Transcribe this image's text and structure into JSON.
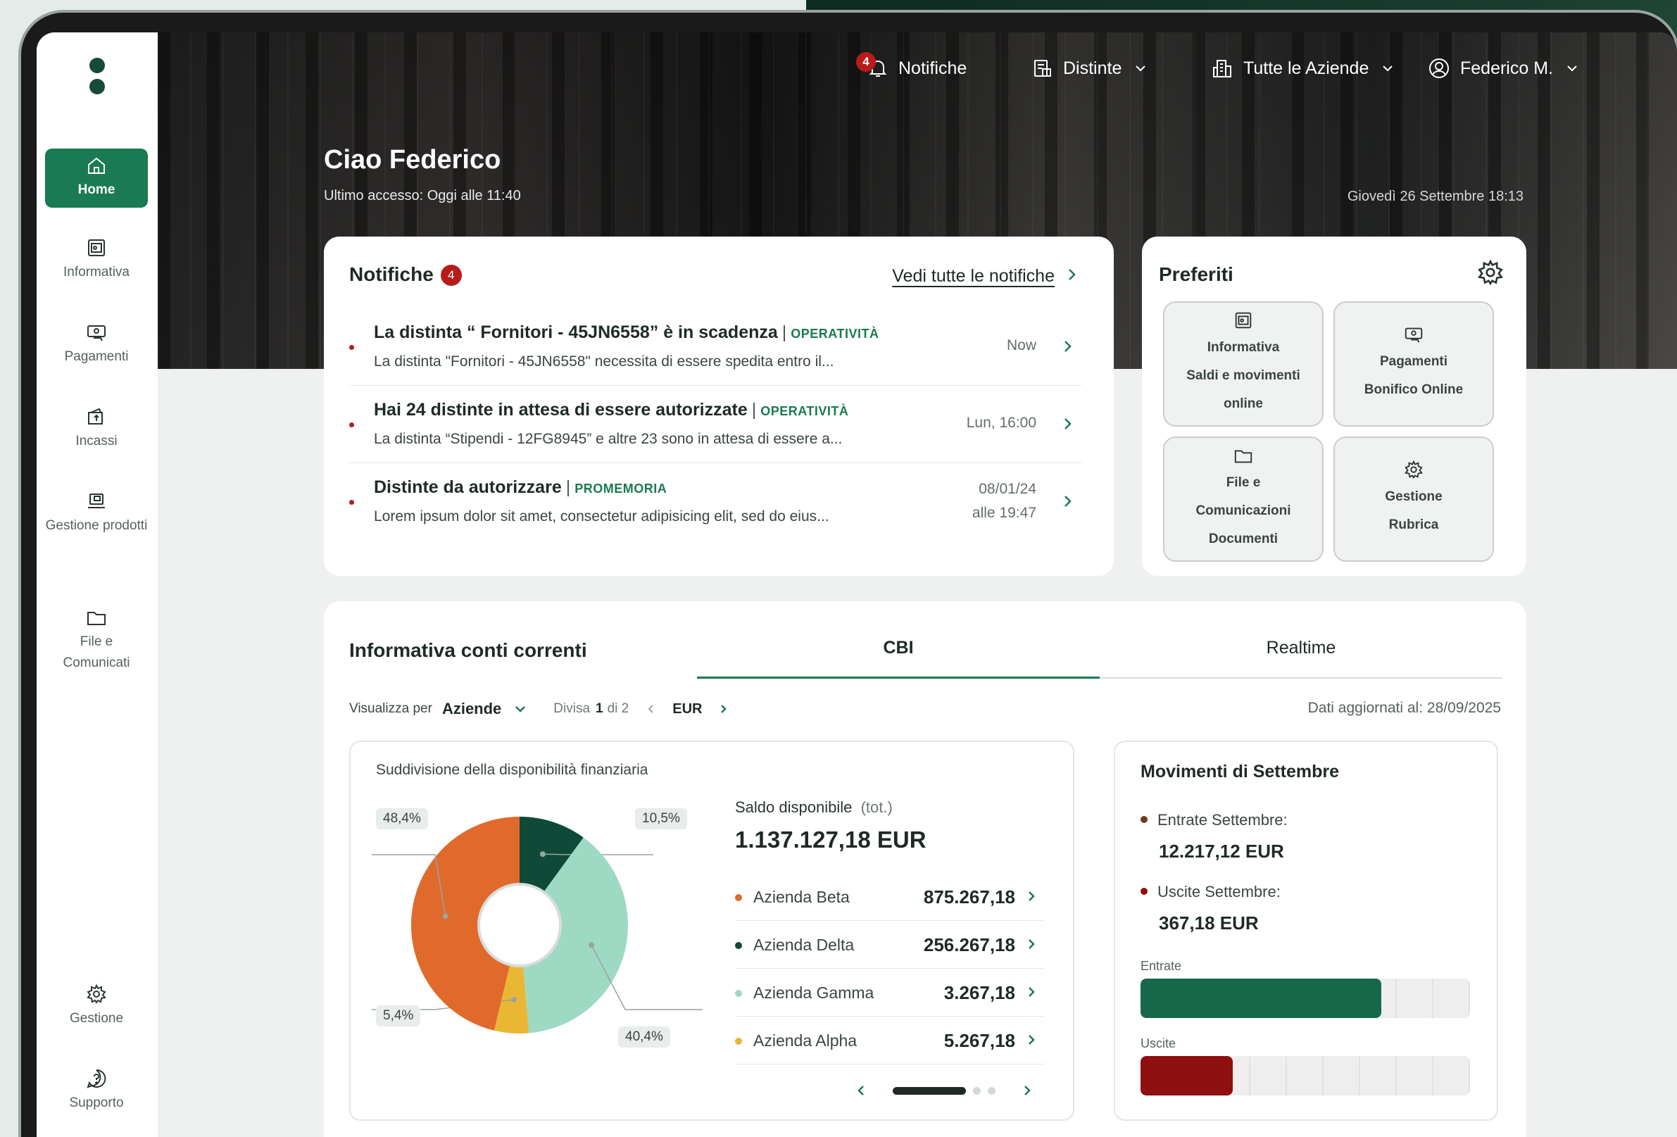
{
  "header": {
    "notifications_label": "Notifiche",
    "notifications_count": "4",
    "distinte_label": "Distinte",
    "aziende_label": "Tutte le Aziende",
    "user_label": "Federico M."
  },
  "sidebar": {
    "items": [
      {
        "label": "Home"
      },
      {
        "label": "Informativa"
      },
      {
        "label": "Pagamenti"
      },
      {
        "label": "Incassi"
      },
      {
        "label": "Gestione prodotti"
      },
      {
        "label": "File e Comunicati"
      }
    ],
    "bottom": [
      {
        "label": "Gestione"
      },
      {
        "label": "Supporto"
      }
    ]
  },
  "greeting": {
    "title": "Ciao Federico",
    "last_access": "Ultimo accesso: Oggi alle 11:40",
    "datetime": "Giovedì 26 Settembre 18:13"
  },
  "notifications": {
    "title": "Notifiche",
    "count": "4",
    "see_all": "Vedi tutte le notifiche",
    "items": [
      {
        "title": "La distinta “ Fornitori - 45JN6558” è in scadenza",
        "tag": "OPERATIVITÀ",
        "desc": "La distinta \"Fornitori - 45JN6558\" necessita di essere spedita entro il...",
        "time": "Now",
        "time2": ""
      },
      {
        "title": "Hai 24 distinte in attesa di essere autorizzate",
        "tag": "OPERATIVITÀ",
        "desc": "La distinta “Stipendi - 12FG8945” e altre 23 sono in attesa di essere a...",
        "time": "Lun, 16:00",
        "time2": ""
      },
      {
        "title": "Distinte da autorizzare",
        "tag": "PROMEMORIA",
        "desc": "Lorem ipsum dolor sit amet, consectetur adipisicing elit, sed do eius...",
        "time": "08/01/24",
        "time2": "alle 19:47"
      }
    ]
  },
  "preferiti": {
    "title": "Preferiti",
    "tiles": [
      {
        "lines": [
          "Informativa",
          "Saldi e movimenti",
          "online"
        ]
      },
      {
        "lines": [
          "Pagamenti",
          "Bonifico Online"
        ]
      },
      {
        "lines": [
          "File e",
          "Comunicazioni",
          "Documenti"
        ]
      },
      {
        "lines": [
          "Gestione",
          "Rubrica"
        ]
      }
    ]
  },
  "informativa": {
    "title": "Informativa conti correnti",
    "tabs": [
      "CBI",
      "Realtime"
    ],
    "view_by_label": "Visualizza per",
    "view_by_value": "Aziende",
    "divisa_label": "Divisa",
    "divisa_page": "1",
    "divisa_of": "di 2",
    "currency": "EUR",
    "updated": "Dati aggiornati al: 28/09/2025",
    "chart_subtitle": "Suddivisione della disponibilità finanziaria",
    "saldo_label": "Saldo disponibile",
    "saldo_suffix": "(tot.)",
    "saldo_value": "1.137.127,18 EUR",
    "aziende": [
      {
        "name": "Azienda Beta",
        "value": "875.267,18",
        "color": "#e06a2c"
      },
      {
        "name": "Azienda Delta",
        "value": "256.267,18",
        "color": "#0e4a37"
      },
      {
        "name": "Azienda Gamma",
        "value": "3.267,18",
        "color": "#9ed9c4"
      },
      {
        "name": "Azienda Alpha",
        "value": "5.267,18",
        "color": "#eab735"
      }
    ]
  },
  "chart_data": {
    "type": "pie",
    "title": "Suddivisione della disponibilità finanziaria",
    "slices": [
      {
        "label": "10,5%",
        "value": 10.5,
        "color": "#0e4a37"
      },
      {
        "label": "40,4%",
        "value": 40.4,
        "color": "#9ed9c4"
      },
      {
        "label": "5,4%",
        "value": 5.4,
        "color": "#eab735"
      },
      {
        "label": "48,4%",
        "value": 48.4,
        "color": "#e06a2c"
      }
    ]
  },
  "movimenti": {
    "title": "Movimenti di Settembre",
    "entrate_label": "Entrate Settembre:",
    "entrate_value": "12.217,12 EUR",
    "uscite_label": "Uscite Settembre:",
    "uscite_value": "367,18 EUR",
    "bar_entrate_label": "Entrate",
    "bar_uscite_label": "Uscite",
    "entrate_fraction": 0.73,
    "uscite_fraction": 0.28,
    "entrate_color": "#17684a",
    "uscite_color": "#8e1010"
  }
}
